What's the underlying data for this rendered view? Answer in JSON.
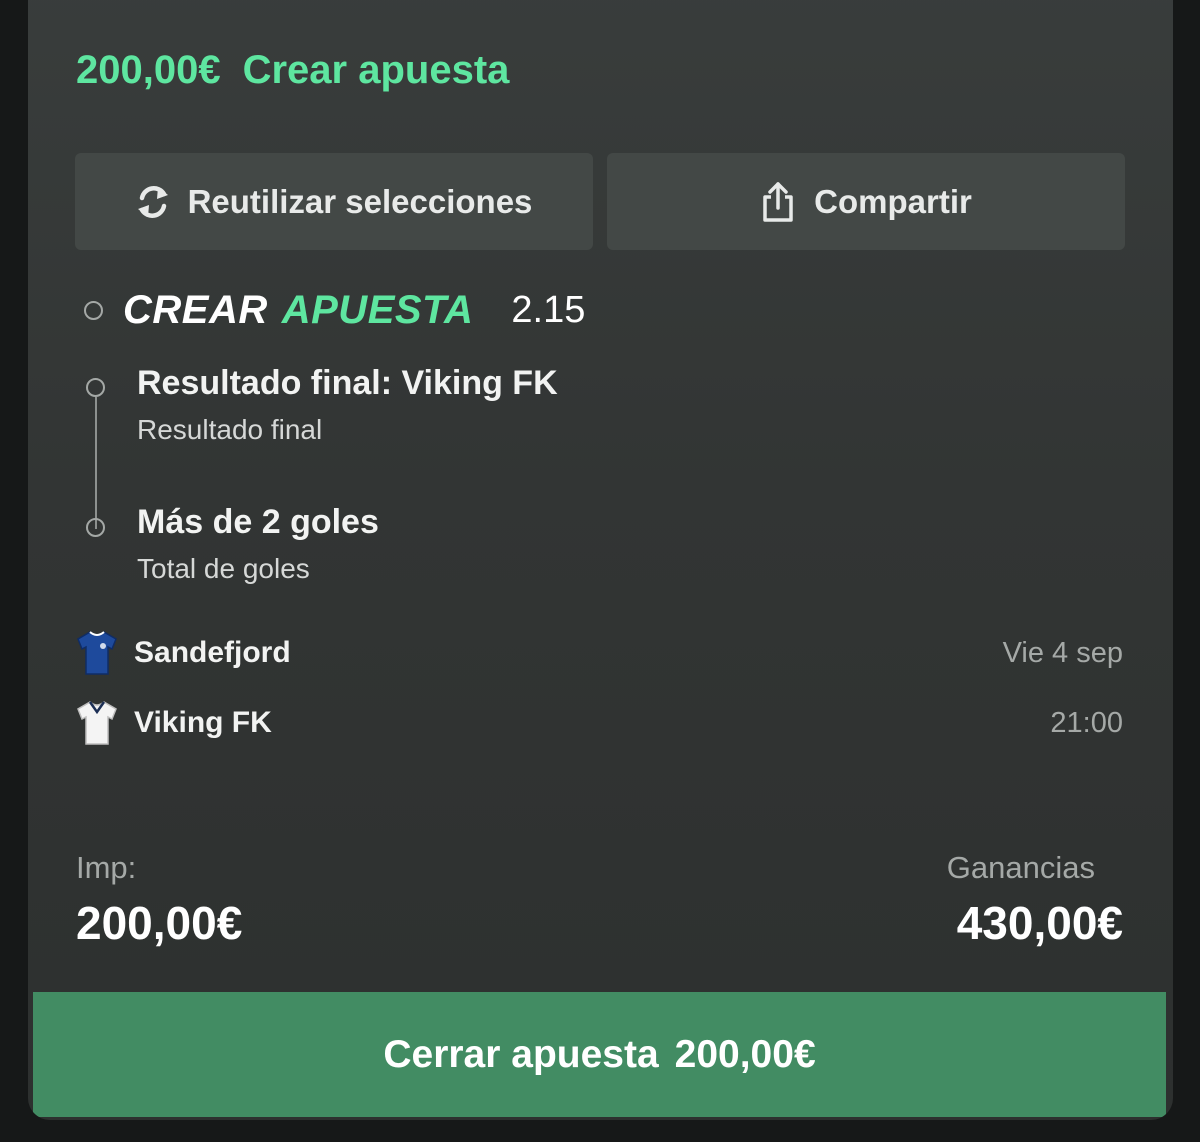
{
  "header": {
    "amount": "200,00€",
    "title": "Crear apuesta"
  },
  "actions": {
    "reuse_label": "Reutilizar selecciones",
    "share_label": "Compartir"
  },
  "bet_builder": {
    "word1": "CREAR",
    "word2": "APUESTA",
    "odds": "2.15"
  },
  "selections": [
    {
      "title": "Resultado final: Viking FK",
      "market": "Resultado final"
    },
    {
      "title": "Más de 2 goles",
      "market": "Total de goles"
    }
  ],
  "event": {
    "home": "Sandefjord",
    "away": "Viking FK",
    "date": "Vie 4 sep",
    "time": "21:00"
  },
  "summary": {
    "stake_label": "Imp:",
    "stake_value": "200,00€",
    "winnings_label": "Ganancias",
    "winnings_value": "430,00€"
  },
  "place_bet": {
    "label": "Cerrar apuesta",
    "amount": "200,00€"
  },
  "colors": {
    "accent": "#5ee6a0",
    "button": "#428c63",
    "card": "#353938"
  },
  "icons": {
    "reuse": "refresh-icon",
    "share": "share-icon",
    "home_kit": "blue-shirt-icon",
    "away_kit": "white-shirt-icon"
  }
}
